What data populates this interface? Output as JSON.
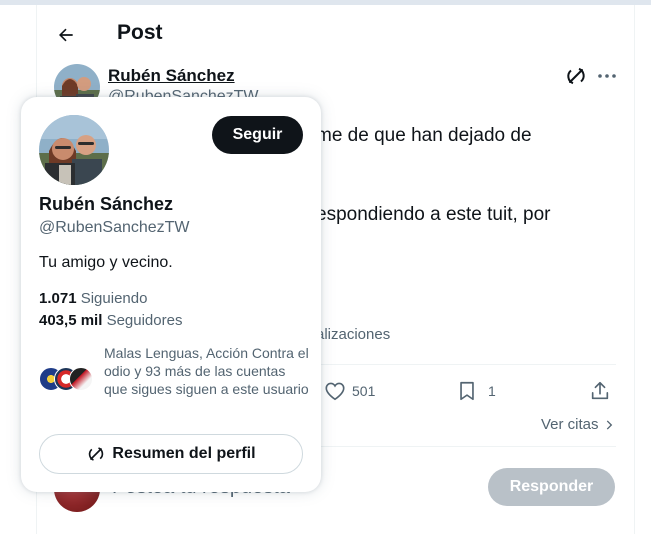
{
  "header": {
    "title": "Post"
  },
  "author": {
    "name": "Rubén Sánchez",
    "handle": "@RubenSanchezTW"
  },
  "tweet": {
    "line1": "me de que han dejado de",
    "line2": "espondiendo a este tuit, por",
    "views_text": "alizaciones"
  },
  "actions": {
    "likes": "501",
    "bookmarks": "1"
  },
  "quotes_link": "Ver citas",
  "reply": {
    "placeholder": "Postea tu respuesta",
    "button": "Responder"
  },
  "hovercard": {
    "follow_button": "Seguir",
    "name": "Rubén Sánchez",
    "handle": "@RubenSanchezTW",
    "bio": "Tu amigo y vecino.",
    "following_count": "1.071",
    "following_label": "Siguiendo",
    "followers_count": "403,5 mil",
    "followers_label": "Seguidores",
    "mutual_text": "Malas Lenguas, Acción Contra el odio y 93 más de las cuentas que sigues siguen a este usuario",
    "summary_button": "Resumen del perfil"
  },
  "colors": {
    "text": "#0f1419",
    "secondary": "#536471",
    "border": "#cfd9de"
  }
}
